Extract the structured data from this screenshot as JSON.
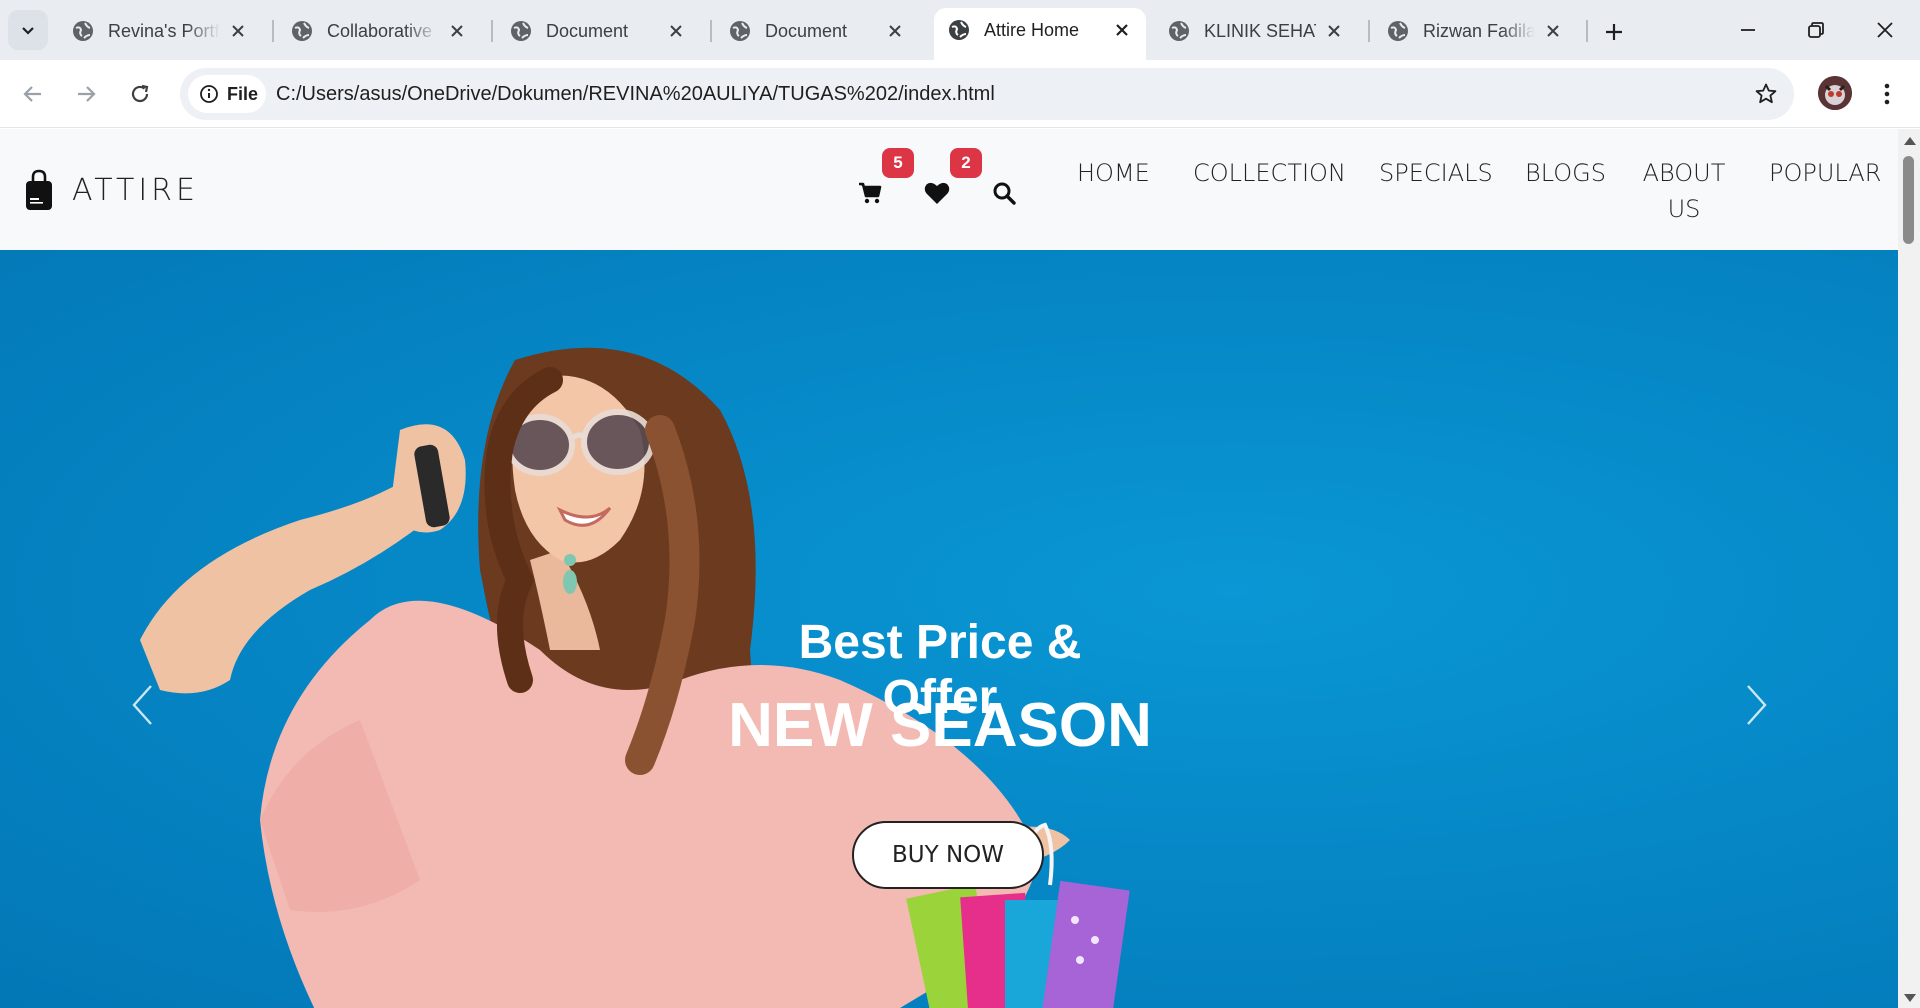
{
  "browser": {
    "tabs": [
      {
        "title": "Revina's Portfolio",
        "active": false
      },
      {
        "title": "Collaborative Learning",
        "active": false
      },
      {
        "title": "Document",
        "active": false
      },
      {
        "title": "Document",
        "active": false
      },
      {
        "title": "Attire Home",
        "active": true
      },
      {
        "title": "KLINIK SEHAT",
        "active": false
      },
      {
        "title": "Rizwan Fadilah",
        "active": false
      }
    ],
    "address_chip": "File",
    "url": "C:/Users/asus/OneDrive/Dokumen/REVINA%20AULIYA/TUGAS%202/index.html"
  },
  "site": {
    "brand": "ATTIRE",
    "cart_count": "5",
    "wishlist_count": "2",
    "menu": [
      {
        "label": "HOME"
      },
      {
        "label": "COLLECTION"
      },
      {
        "label": "SPECIALS"
      },
      {
        "label": "BLOGS"
      },
      {
        "label": "ABOUT US"
      },
      {
        "label": "POPULAR"
      }
    ]
  },
  "hero": {
    "subtitle": "Best Price & Offer",
    "headline": "NEW SEASON",
    "button": "BUY NOW"
  },
  "icons": {
    "cart": "shopping-cart-icon",
    "wishlist": "heart-icon",
    "search": "search-icon",
    "brand": "shopping-bag-icon",
    "prev": "chevron-left-icon",
    "next": "chevron-right-icon"
  },
  "colors": {
    "hero_bg": "#0688c7",
    "badge": "#dc3545",
    "navbar_bg": "#f8f9fa"
  }
}
